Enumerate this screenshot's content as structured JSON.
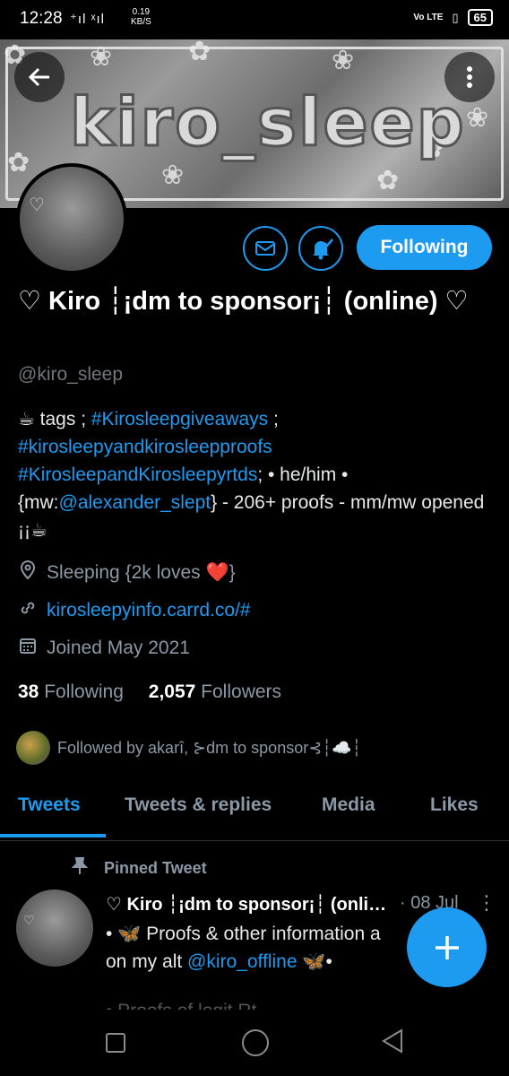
{
  "status_bar": {
    "time": "12:28",
    "signal": "⁺ıl ˣıl",
    "speed_value": "0.19",
    "speed_unit": "KB/S",
    "volte": "Vo LTE",
    "battery": "65"
  },
  "banner": {
    "logo_text": "kiro_sleep"
  },
  "profile": {
    "follow_button": "Following",
    "display_name": "♡ Kiro ┆¡dm to sponsor¡┆ (online) ♡",
    "handle": "@kiro_sleep",
    "bio": {
      "p1": "☕ tags ; ",
      "tag1": "#Kirosleepgiveaways",
      "p2": " ;",
      "tag2": "#kirosleepyandkirosleepproofs",
      "tag3": "#KirosleepandKirosleepyrtds",
      "p3": "; • he/him •",
      "p4": "{mw:",
      "mention": "@alexander_slept",
      "p5": "} - 206+ proofs - mm/mw opened ¡¡☕"
    },
    "location": "Sleeping {2k loves ❤️}",
    "website": "kirosleepyinfo.carrd.co/#",
    "joined": "Joined May 2021",
    "following_count": "38",
    "following_label": "Following",
    "followers_count": "2,057",
    "followers_label": "Followers",
    "followed_by": "Followed by akarî, ⊱dm to sponsor⊰┆☁️┆"
  },
  "tabs": [
    "Tweets",
    "Tweets & replies",
    "Media",
    "Likes"
  ],
  "pinned_tweet": {
    "pinned_label": "Pinned Tweet",
    "author": "♡ Kiro ┆¡dm to sponsor¡┆ (online) ♡",
    "date": "· 08 Jul",
    "line1": "• 🦋 Proofs & other information a",
    "line2_prefix": "on my alt ",
    "mention": "@kiro_offline",
    "line2_suffix": " 🦋•",
    "cut_line": "• Proofs of legit Rt"
  },
  "icons": {
    "back": "arrow-left",
    "more": "more-vertical",
    "message": "envelope",
    "notify": "bell-check",
    "location": "pin",
    "link": "link",
    "calendar": "calendar",
    "pin": "push-pin",
    "compose": "plus"
  },
  "colors": {
    "accent": "#1d9bf0",
    "background": "#000000",
    "secondary_text": "#8b98a5"
  }
}
